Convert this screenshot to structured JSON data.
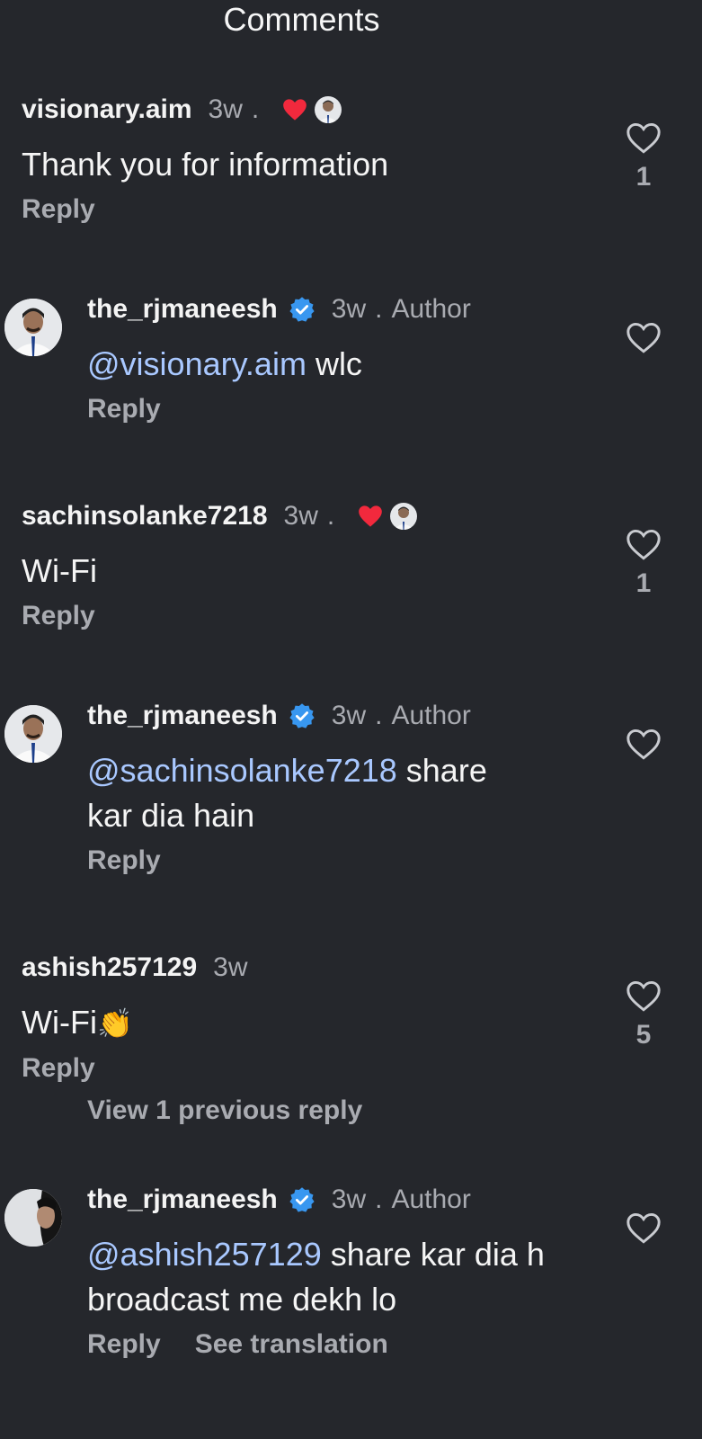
{
  "header": {
    "title": "Comments"
  },
  "comments": [
    {
      "username": "visionary.aim",
      "time": "3w",
      "dot": ".",
      "text": "Thank you for information",
      "reply_label": "Reply",
      "likes": "1",
      "liked_by_author": true,
      "heart_color": "#f2293d"
    },
    {
      "username": "the_rjmaneesh",
      "verified": true,
      "time": "3w",
      "dot": ".",
      "author_label": "Author",
      "mention": "@visionary.aim",
      "text": " wlc",
      "reply_label": "Reply"
    },
    {
      "username": "sachinsolanke7218",
      "time": "3w",
      "dot": ".",
      "text": "Wi-Fi",
      "reply_label": "Reply",
      "likes": "1",
      "liked_by_author": true,
      "heart_color": "#f2293d"
    },
    {
      "username": "the_rjmaneesh",
      "verified": true,
      "time": "3w",
      "dot": ".",
      "author_label": "Author",
      "mention": "@sachinsolanke7218",
      "text": " share kar dia hain",
      "reply_label": "Reply"
    },
    {
      "username": "ashish257129",
      "time": "3w",
      "text": "Wi-Fi",
      "emoji": "👏",
      "reply_label": "Reply",
      "likes": "5"
    },
    {
      "username": "the_rjmaneesh",
      "verified": true,
      "time": "3w",
      "dot": ".",
      "author_label": "Author",
      "mention": "@ashish257129",
      "text": " share kar dia h broadcast me dekh lo",
      "reply_label": "Reply",
      "translate_label": "See translation"
    }
  ],
  "view_previous_replies": "View 1 previous reply",
  "icons": {
    "like": "heart-outline-icon",
    "liked": "heart-filled-icon",
    "verified": "verified-badge-icon"
  },
  "colors": {
    "background": "#25272c",
    "mention": "#a9c8ff",
    "verified": "#3897f0",
    "muted": "#a9abb1"
  }
}
